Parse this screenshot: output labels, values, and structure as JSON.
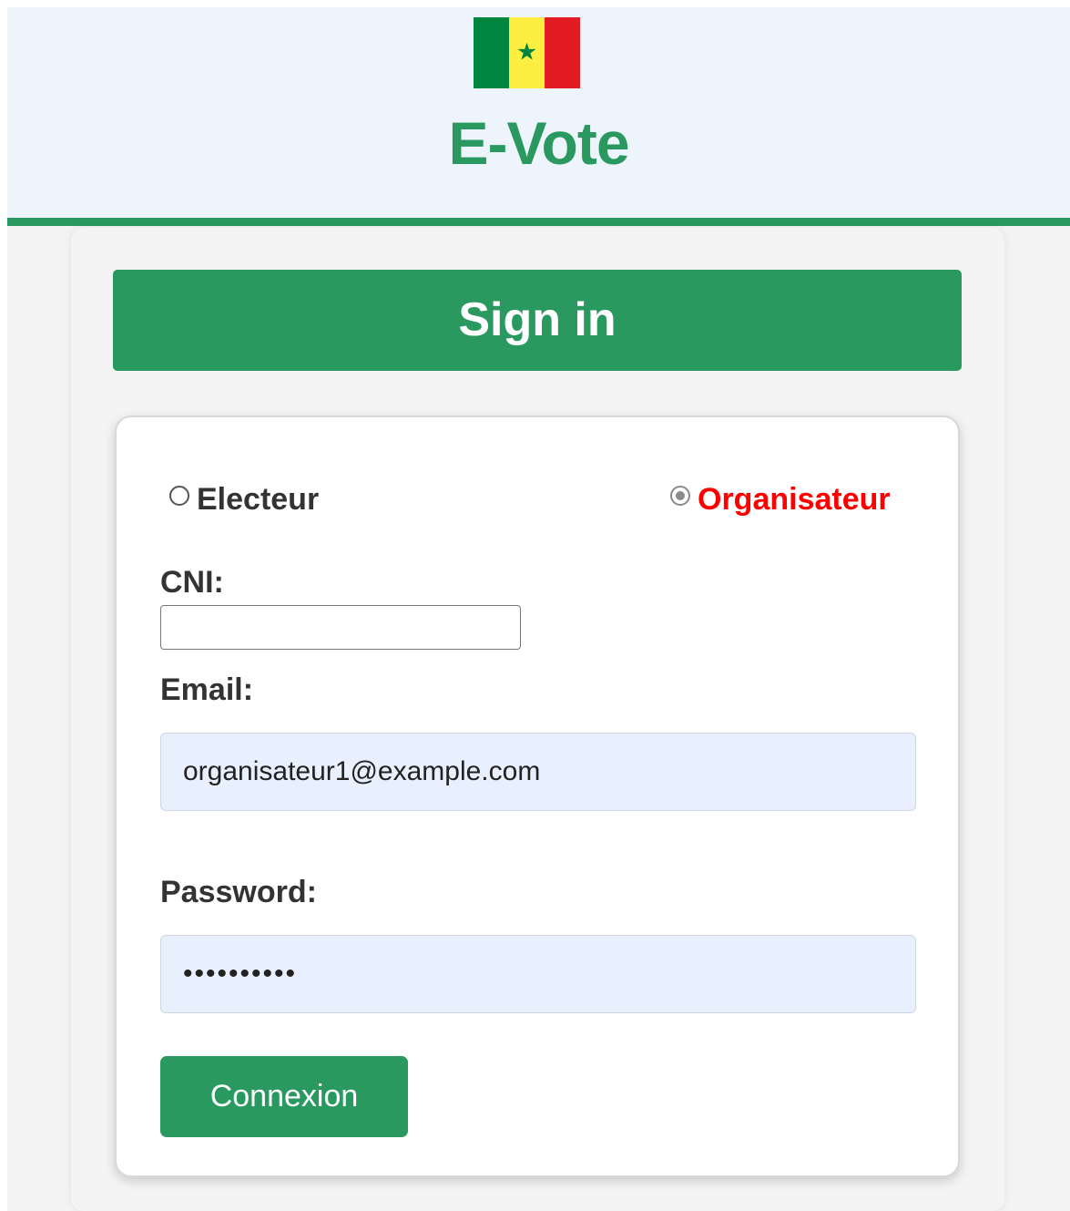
{
  "header": {
    "app_title": "E-Vote",
    "flag_icon": "senegal-flag-icon",
    "accent_color": "#2a9960"
  },
  "banner": {
    "title": "Sign in"
  },
  "form": {
    "roles": [
      {
        "label": "Electeur",
        "selected": false
      },
      {
        "label": "Organisateur",
        "selected": true
      }
    ],
    "cni": {
      "label": "CNI:",
      "value": ""
    },
    "email": {
      "label": "Email:",
      "value": "organisateur1@example.com"
    },
    "password": {
      "label": "Password:",
      "value": "••••••••••"
    },
    "submit_label": "Connexion"
  }
}
